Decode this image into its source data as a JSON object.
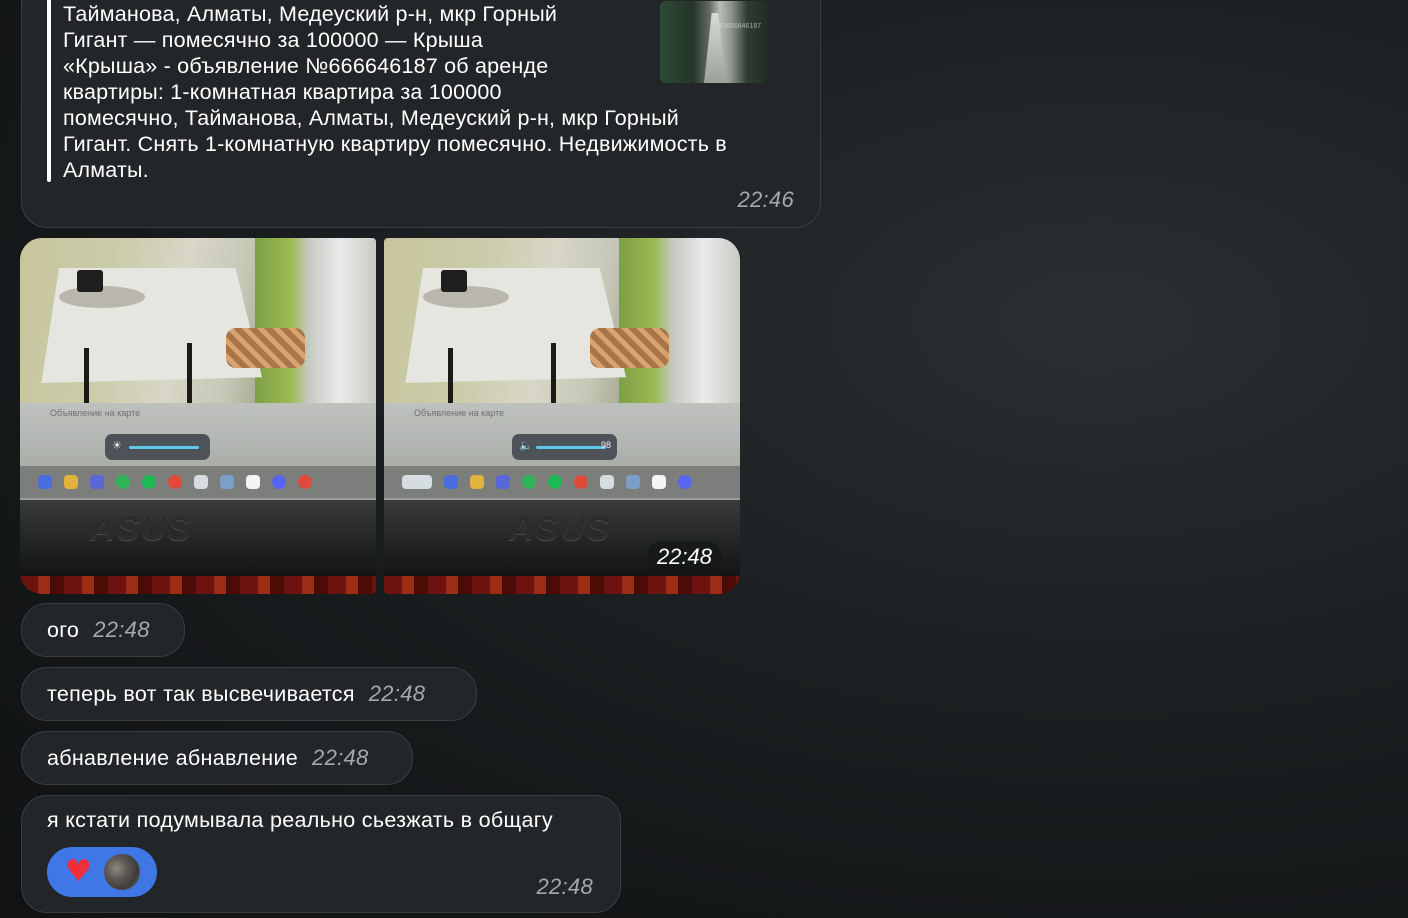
{
  "preview": {
    "text": "Тайманова, Алматы, Медеуский р-н, мкр Горный\nГигант — помесячно за 100000 — Крыша\n«Крыша» - объявление №666646187 об аренде\nквартиры: 1-комнатная квартира за 100000\nпомесячно, Тайманова, Алматы, Медеуский р-н, мкр Горный\nГигант. Снять 1-комнатную квартиру помесячно. Недвижимость в\nАлматы.",
    "time": "22:46",
    "thumb_watermark": "ID666646187"
  },
  "album": {
    "time": "22:48",
    "photo1": {
      "brand": "ASUS",
      "map_title": "Объявление на карте",
      "control_icon": "☀"
    },
    "photo2": {
      "brand": "ASUS",
      "map_title": "Объявление на карте",
      "control_icon": "🔈",
      "volume_value": "98"
    }
  },
  "messages": [
    {
      "text": "ого",
      "time": "22:48"
    },
    {
      "text": "теперь вот так высвечивается",
      "time": "22:48"
    },
    {
      "text": "абнавление абнавление",
      "time": "22:48"
    },
    {
      "text": "я кстати подумывала реально сьезжать в общагу",
      "time": "22:48",
      "reaction": "♥"
    }
  ],
  "colors": {
    "bubble": "#232628",
    "bubble_border": "#3a3e41",
    "reaction_bg": "#3f78e6",
    "heart": "#f02d3a",
    "time_text": "#a3a9ae"
  }
}
